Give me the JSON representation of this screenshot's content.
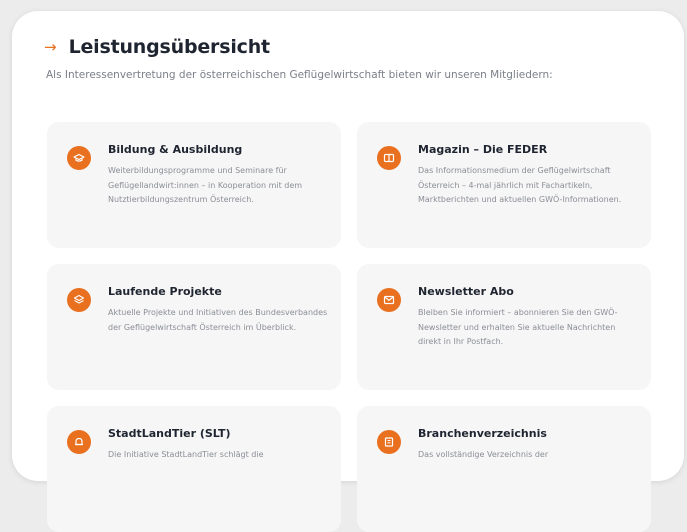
{
  "header": {
    "title": "Leistungsübersicht",
    "intro": "Als Interessenvertretung der österreichischen Geflügelwirtschaft bieten wir unseren Mitgliedern:"
  },
  "accent_color": "#e8701f",
  "cards": [
    {
      "title": "Bildung & Ausbildung",
      "desc": "Weiterbildungsprogramme und Seminare für Geflügellandwirt:innen – in Kooperation mit dem Nutztierbildungszentrum Österreich.",
      "icon": "graduation-cap-icon"
    },
    {
      "title": "Magazin – Die FEDER",
      "desc": "Das Informationsmedium der Geflügelwirtschaft Österreich – 4-mal jährlich mit Fachartikeln, Marktberichten und aktuellen GWÖ-Informationen.",
      "icon": "book-icon"
    },
    {
      "title": "Laufende Projekte",
      "desc": "Aktuelle Projekte und Initiativen des Bundesverbandes der Geflügelwirtschaft Österreich im Überblick.",
      "icon": "layers-icon"
    },
    {
      "title": "Newsletter Abo",
      "desc": "Bleiben Sie informiert – abonnieren Sie den GWÖ-Newsletter und erhalten Sie aktuelle Nachrichten direkt in Ihr Postfach.",
      "icon": "envelope-icon"
    },
    {
      "title": "StadtLandTier (SLT)",
      "desc": "Die Initiative StadtLandTier schlägt die",
      "icon": "bell-icon"
    },
    {
      "title": "Branchenverzeichnis",
      "desc": "Das vollständige Verzeichnis der",
      "icon": "building-icon"
    }
  ]
}
